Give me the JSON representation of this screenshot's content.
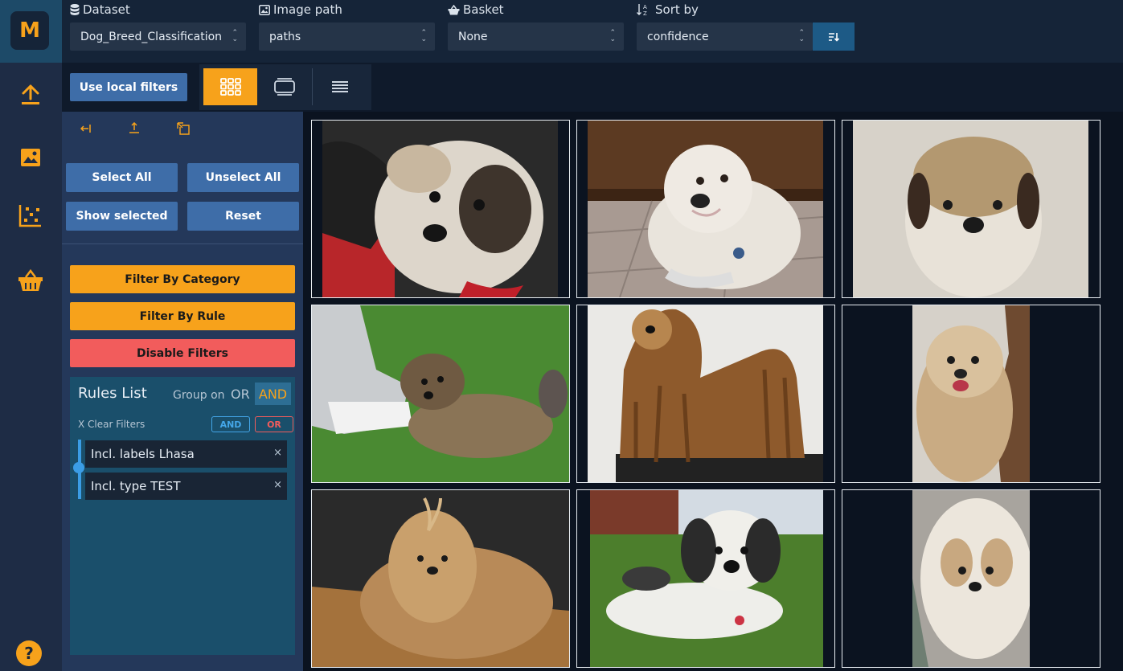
{
  "app": {
    "logo_letter": "M"
  },
  "topbar": {
    "dataset": {
      "label": "Dataset",
      "value": "Dog_Breed_Classification"
    },
    "image_path": {
      "label": "Image path",
      "value": "paths"
    },
    "basket": {
      "label": "Basket",
      "value": "None"
    },
    "sort_by": {
      "label": "Sort by",
      "value": "confidence"
    }
  },
  "toolbar": {
    "use_local_filters": "Use local filters"
  },
  "panel": {
    "select_all": "Select All",
    "unselect_all": "Unselect All",
    "show_selected": "Show selected",
    "reset": "Reset",
    "filter_by_category": "Filter By Category",
    "filter_by_rule": "Filter By Rule",
    "disable_filters": "Disable Filters"
  },
  "rules": {
    "title": "Rules List",
    "group_on": "Group on",
    "or_label": "OR",
    "and_label": "AND",
    "clear_filters": "X Clear Filters",
    "pill_and": "AND",
    "pill_or": "OR",
    "items": [
      {
        "label": "Incl. labels Lhasa",
        "remove": "×"
      },
      {
        "label": "Incl. type TEST",
        "remove": "×"
      }
    ]
  },
  "help": {
    "label": "?"
  },
  "colors": {
    "accent": "#f7a21b",
    "primary_button": "#3e6da8",
    "danger": "#f25c5c",
    "panel_bg": "#24385a",
    "rules_bg": "#1a4f6b"
  },
  "icons": {
    "rail": [
      "upload-icon",
      "image-icon",
      "scatter-plot-icon",
      "basket-icon",
      "help-icon"
    ],
    "view_modes": [
      "grid-view-icon",
      "carousel-view-icon",
      "list-view-icon"
    ],
    "panel_tools": [
      "collapse-left-icon",
      "upload-icon",
      "expand-icon"
    ]
  },
  "gallery": {
    "items": [
      {
        "label": "shih tzu puppy, brown white black"
      },
      {
        "label": "white dog on tile floor"
      },
      {
        "label": "fluffy puppy on carpet"
      },
      {
        "label": "puppy on grass by shoes"
      },
      {
        "label": "long hair lhasa on table"
      },
      {
        "label": "cream dog tongue out"
      },
      {
        "label": "long haired dog on wood floor"
      },
      {
        "label": "black white dog on grass"
      },
      {
        "label": "white dog portrait"
      }
    ]
  }
}
